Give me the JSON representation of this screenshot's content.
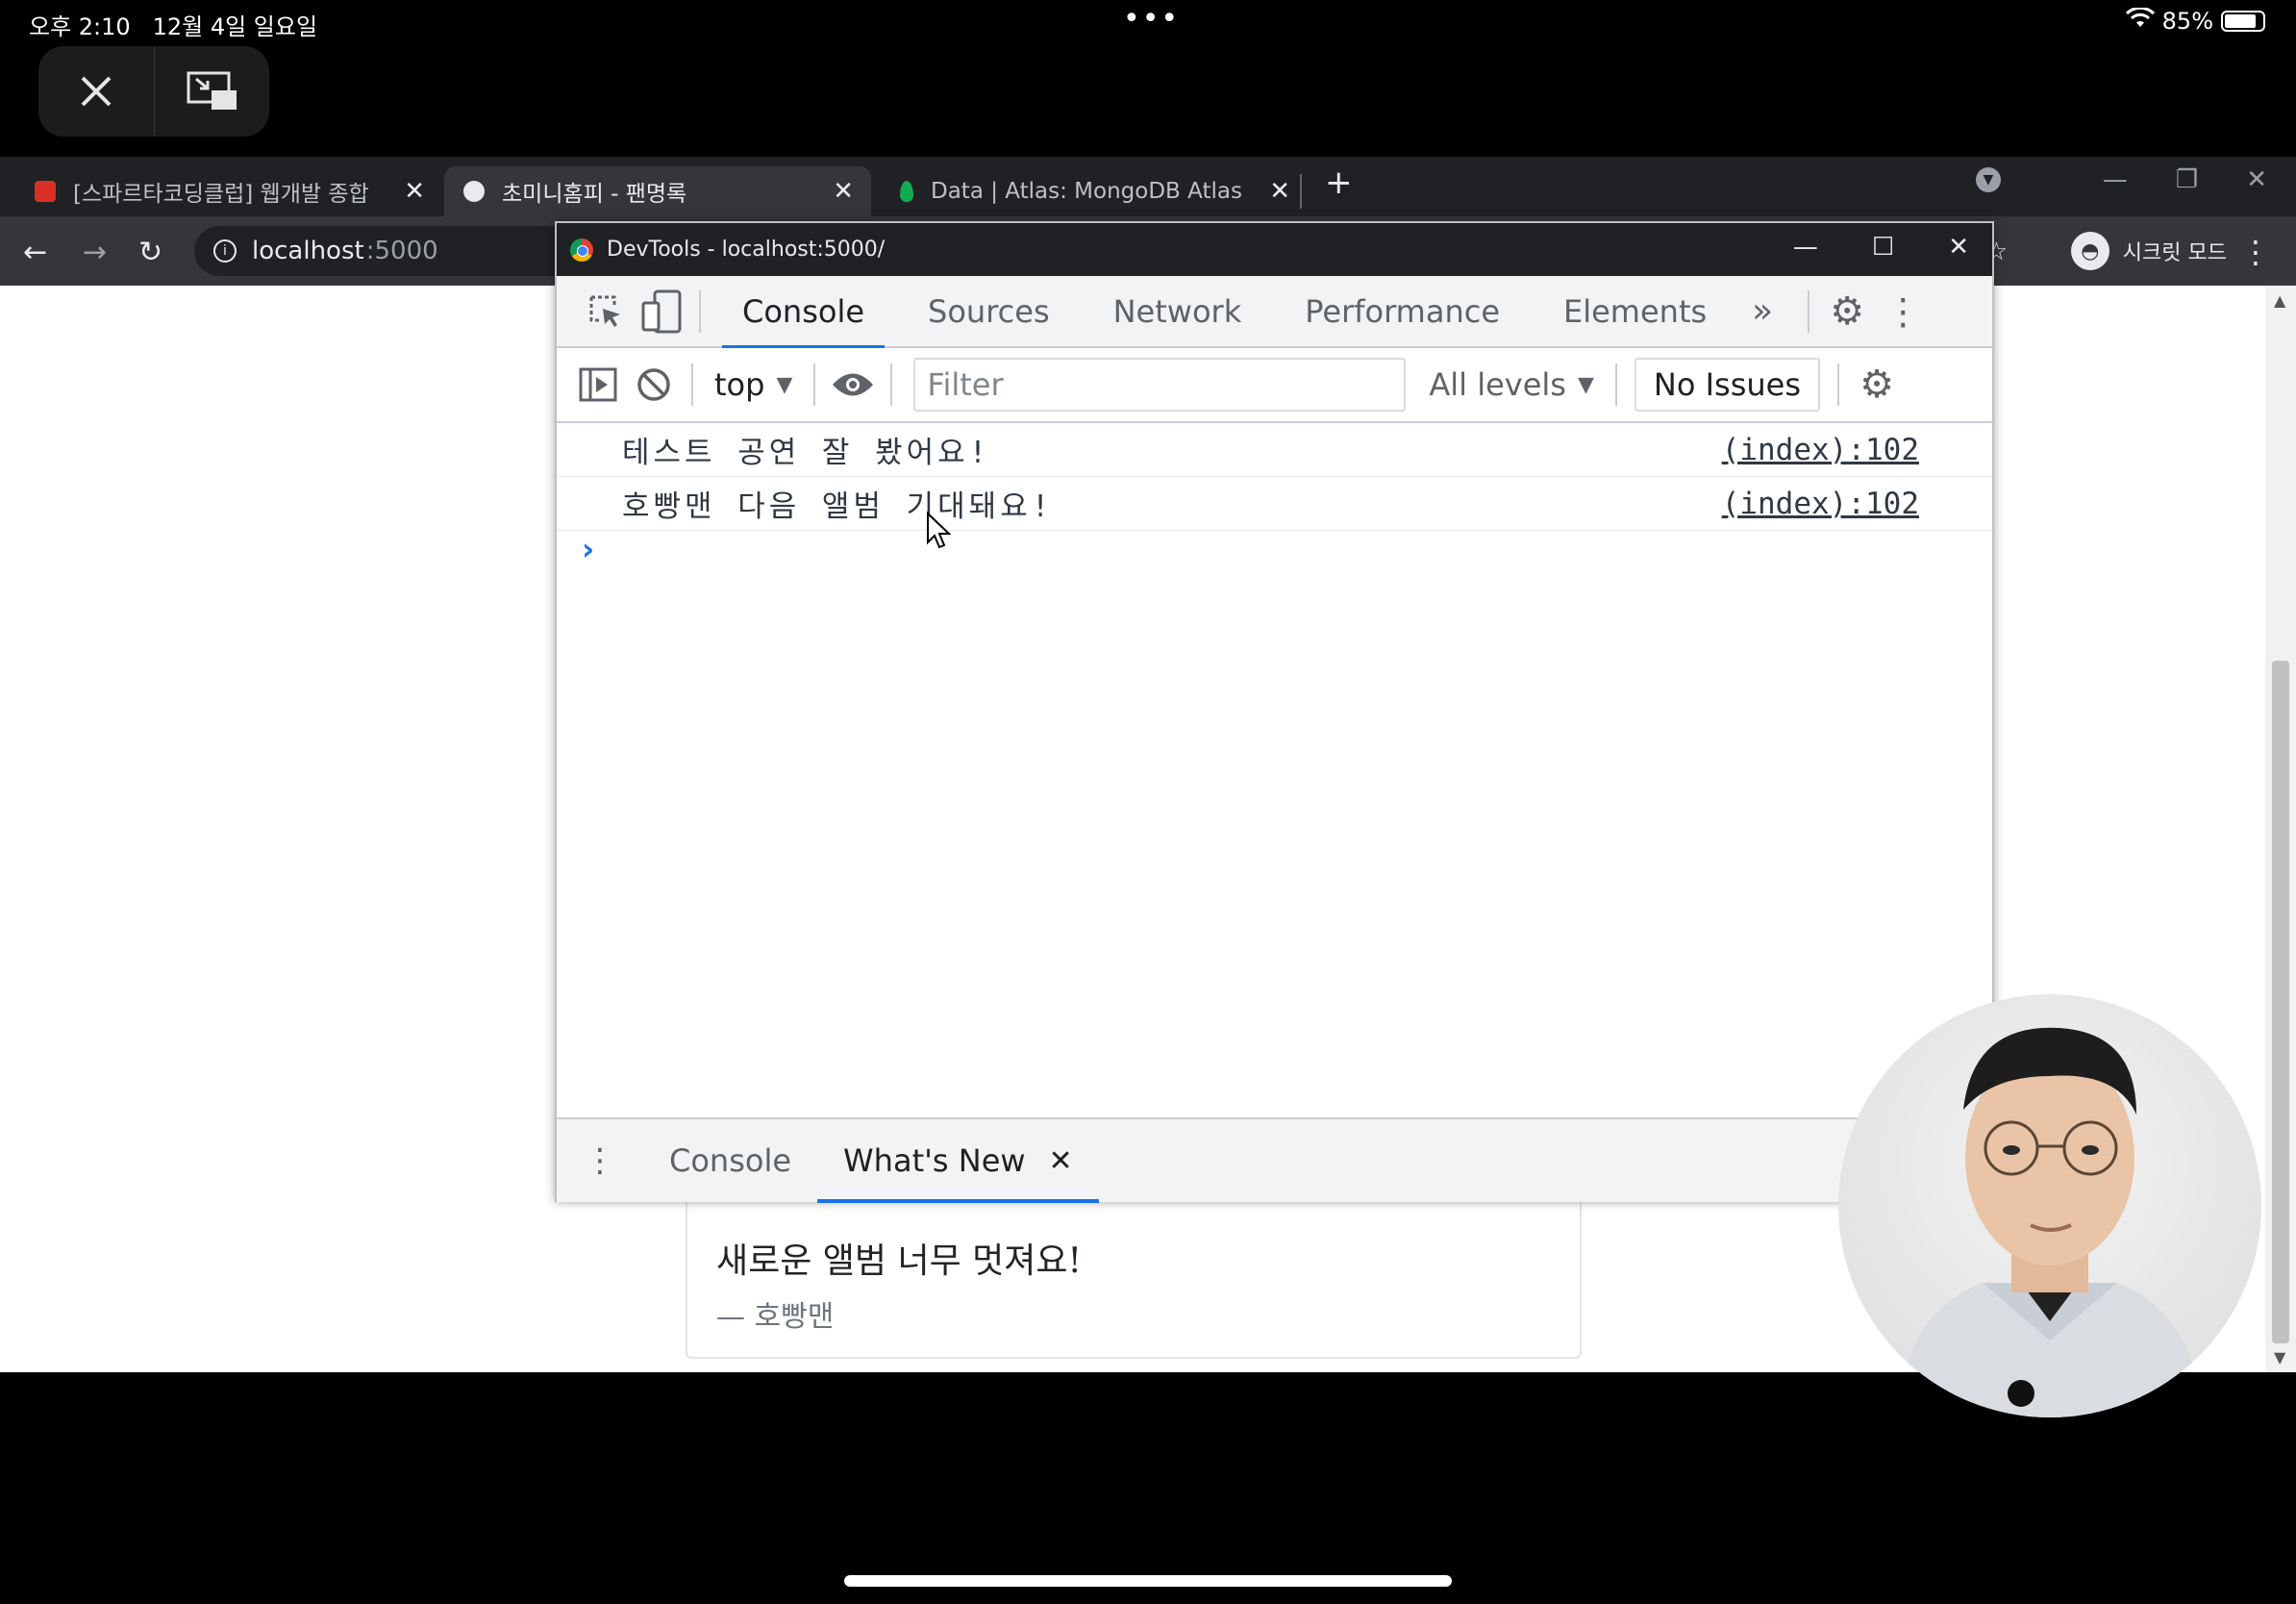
{
  "status_bar": {
    "time": "오후 2:10",
    "date": "12월 4일 일요일",
    "battery": "85%",
    "battery_level": 0.85,
    "dots": "•••"
  },
  "tabs": [
    {
      "title": "[스파르타코딩클럽] 웹개발 종합",
      "favicon_color": "#d93025"
    },
    {
      "title": "초미니홈피 - 팬명록",
      "active": true
    },
    {
      "title": "Data | Atlas: MongoDB Atlas",
      "favicon_color": "#13aa52"
    }
  ],
  "omnibox": {
    "host": "localhost",
    "port": ":5000"
  },
  "incognito_label": "시크릿 모드",
  "devtools": {
    "title": "DevTools - localhost:5000/",
    "tabs": [
      "Console",
      "Sources",
      "Network",
      "Performance",
      "Elements"
    ],
    "context": "top",
    "filter_placeholder": "Filter",
    "levels": "All levels",
    "issues": "No Issues",
    "log": [
      {
        "message": "테스트 공연 잘 봤어요!",
        "source": "(index):102"
      },
      {
        "message": "호빵맨 다음 앨범 기대돼요!",
        "source": "(index):102"
      }
    ],
    "prompt": "›",
    "drawer_tabs": [
      "Console",
      "What's New"
    ]
  },
  "page": {
    "comment": "새로운 앨범 너무 멋져요!",
    "author": "— 호빵맨"
  },
  "colors": {
    "accent": "#1a73e8",
    "chrome_dark": "#202124",
    "chrome_toolbar": "#35363a"
  }
}
